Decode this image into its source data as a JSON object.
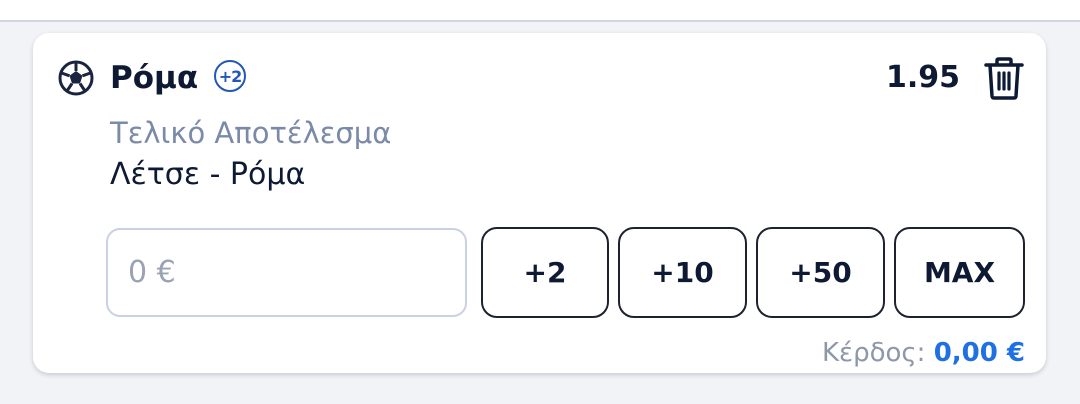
{
  "bet": {
    "sport_icon": "soccer-ball-icon",
    "selection": "Ρόμα",
    "more_count": "+2",
    "odds": "1.95",
    "market": "Τελικό Αποτέλεσμα",
    "event": "Λέτσε - Ρόμα"
  },
  "stake": {
    "placeholder": "0 €",
    "value": ""
  },
  "quick_stakes": [
    "+2",
    "+10",
    "+50",
    "MAX"
  ],
  "winnings": {
    "label": "Κέρδος:",
    "value": "0,00 €"
  },
  "colors": {
    "accent": "#1f6fe5",
    "badge": "#2257b4",
    "text_primary": "#0e1a33",
    "text_muted": "#7a8aa8",
    "border": "#1c2230"
  }
}
